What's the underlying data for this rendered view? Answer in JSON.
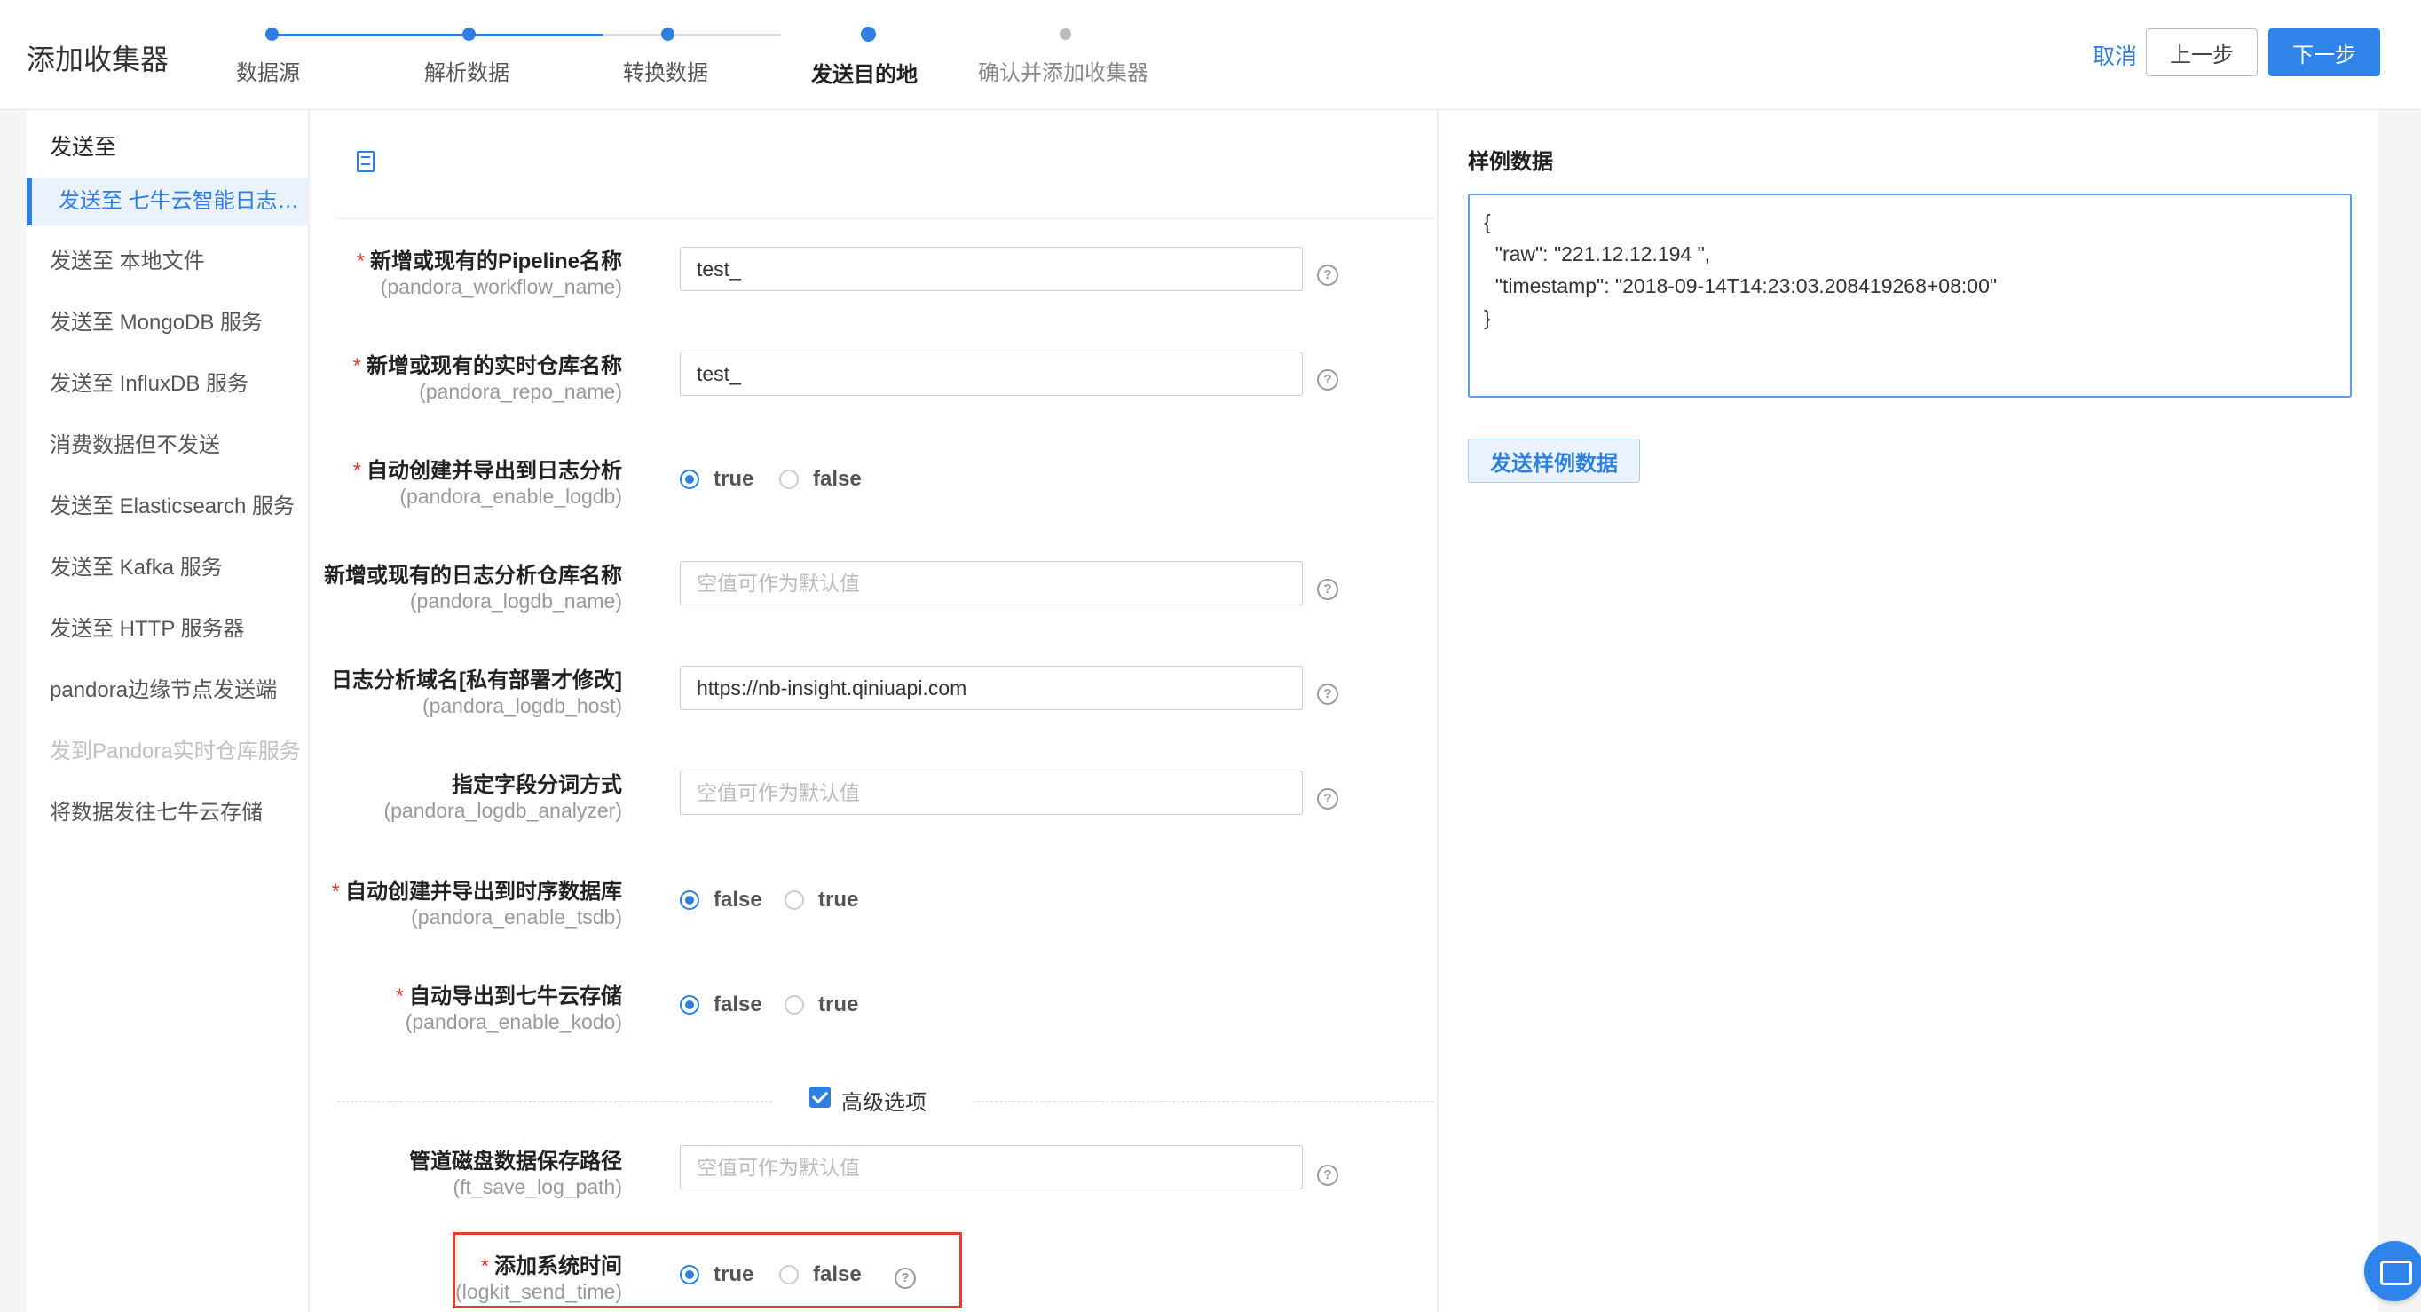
{
  "header": {
    "title": "添加收集器",
    "cancel_label": "取消",
    "prev_label": "上一步",
    "next_label": "下一步"
  },
  "steps": [
    {
      "label": "数据源",
      "state": "done"
    },
    {
      "label": "解析数据",
      "state": "done"
    },
    {
      "label": "转换数据",
      "state": "done"
    },
    {
      "label": "发送目的地",
      "state": "current"
    },
    {
      "label": "确认并添加收集器",
      "state": "pending"
    }
  ],
  "sidebar": {
    "heading": "发送至",
    "items": [
      {
        "label": "发送至 七牛云智能日志分析服务",
        "state": "active"
      },
      {
        "label": "发送至 本地文件",
        "state": "normal"
      },
      {
        "label": "发送至 MongoDB 服务",
        "state": "normal"
      },
      {
        "label": "发送至 InfluxDB 服务",
        "state": "normal"
      },
      {
        "label": "消费数据但不发送",
        "state": "normal"
      },
      {
        "label": "发送至 Elasticsearch 服务",
        "state": "normal"
      },
      {
        "label": "发送至 Kafka 服务",
        "state": "normal"
      },
      {
        "label": "发送至 HTTP 服务器",
        "state": "normal"
      },
      {
        "label": "pandora边缘节点发送端",
        "state": "normal"
      },
      {
        "label": "发到Pandora实时仓库服务",
        "state": "disabled"
      },
      {
        "label": "将数据发往七牛云存储",
        "state": "normal"
      }
    ]
  },
  "form": {
    "fields": [
      {
        "label": "新增或现有的Pipeline名称",
        "key": "(pandora_workflow_name)",
        "required": true,
        "type": "input",
        "value": "test_",
        "placeholder": ""
      },
      {
        "label": "新增或现有的实时仓库名称",
        "key": "(pandora_repo_name)",
        "required": true,
        "type": "input",
        "value": "test_",
        "placeholder": ""
      },
      {
        "label": "自动创建并导出到日志分析",
        "key": "(pandora_enable_logdb)",
        "required": true,
        "type": "radio",
        "options": [
          "true",
          "false"
        ],
        "selected": 0
      },
      {
        "label": "新增或现有的日志分析仓库名称",
        "key": "(pandora_logdb_name)",
        "required": false,
        "type": "input",
        "value": "",
        "placeholder": "空值可作为默认值"
      },
      {
        "label": "日志分析域名[私有部署才修改]",
        "key": "(pandora_logdb_host)",
        "required": false,
        "type": "input",
        "value": "https://nb-insight.qiniuapi.com",
        "placeholder": ""
      },
      {
        "label": "指定字段分词方式",
        "key": "(pandora_logdb_analyzer)",
        "required": false,
        "type": "input",
        "value": "",
        "placeholder": "空值可作为默认值"
      },
      {
        "label": "自动创建并导出到时序数据库",
        "key": "(pandora_enable_tsdb)",
        "required": true,
        "type": "radio",
        "options": [
          "false",
          "true"
        ],
        "selected": 0
      },
      {
        "label": "自动导出到七牛云存储",
        "key": "(pandora_enable_kodo)",
        "required": true,
        "type": "radio",
        "options": [
          "false",
          "true"
        ],
        "selected": 0
      }
    ],
    "advanced_label": "高级选项",
    "advanced_checked": true,
    "advanced_fields": [
      {
        "label": "管道磁盘数据保存路径",
        "key": "(ft_save_log_path)",
        "required": false,
        "type": "input",
        "value": "",
        "placeholder": "空值可作为默认值"
      },
      {
        "label": "添加系统时间",
        "key": "(logkit_send_time)",
        "required": true,
        "type": "radio",
        "options": [
          "true",
          "false"
        ],
        "selected": 0
      }
    ]
  },
  "sample": {
    "title": "样例数据",
    "content": "{\n  \"raw\": \"221.12.12.194 \",\n  \"timestamp\": \"2018-09-14T14:23:03.208419268+08:00\"\n}",
    "send_label": "发送样例数据"
  },
  "icons": {
    "help": "question-circle-icon",
    "doc": "document-icon",
    "chat": "chat-widget-icon"
  },
  "colors": {
    "accent": "#2f7fe0",
    "required": "#e53935",
    "highlight": "#e33c2a"
  }
}
